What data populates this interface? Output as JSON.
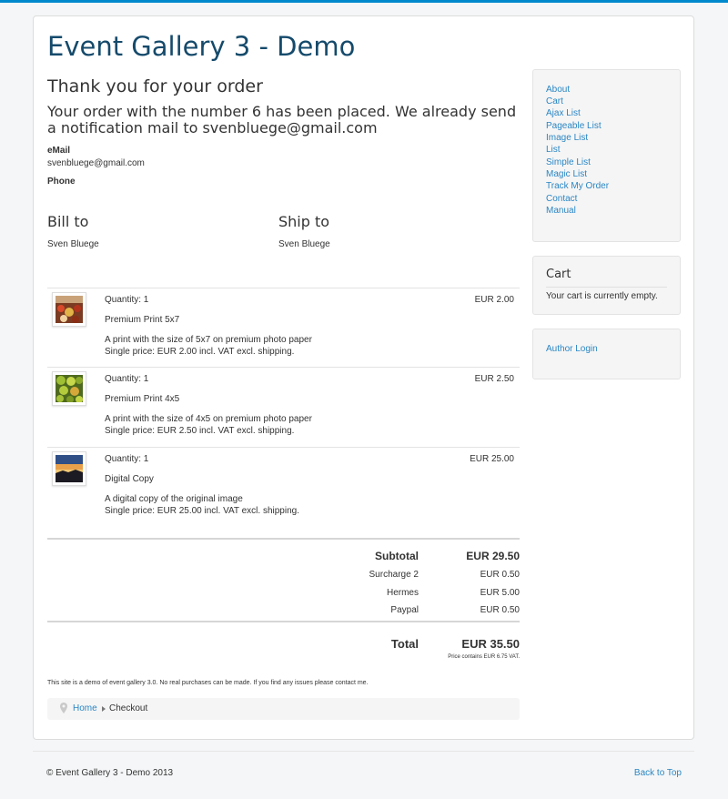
{
  "site": {
    "title": "Event Gallery 3 - Demo"
  },
  "confirmation": {
    "heading": "Thank you for your order",
    "message": "Your order with the number 6 has been placed. We already send a notification mail to svenbluege@gmail.com",
    "email_label": "eMail",
    "email_value": "svenbluege@gmail.com",
    "phone_label": "Phone"
  },
  "addresses": {
    "bill_to": {
      "title": "Bill to",
      "name": "Sven Bluege"
    },
    "ship_to": {
      "title": "Ship to",
      "name": "Sven Bluege"
    }
  },
  "items": [
    {
      "quantity": "Quantity: 1",
      "name": "Premium Print 5x7",
      "description": "A print with the size of 5x7 on premium photo paper",
      "single_price": "Single price: EUR 2.00 incl. VAT excl. shipping.",
      "price": "EUR 2.00",
      "thumb_icon": "market-photo-thumbnail"
    },
    {
      "quantity": "Quantity: 1",
      "name": "Premium Print 4x5",
      "description": "A print with the size of 4x5 on premium photo paper",
      "single_price": "Single price: EUR 2.50 incl. VAT excl. shipping.",
      "price": "EUR 2.50",
      "thumb_icon": "fruit-photo-thumbnail"
    },
    {
      "quantity": "Quantity: 1",
      "name": "Digital Copy",
      "description": "A digital copy of the original image",
      "single_price": "Single price: EUR 25.00 incl. VAT excl. shipping.",
      "price": "EUR 25.00",
      "thumb_icon": "sunset-photo-thumbnail"
    }
  ],
  "totals": {
    "subtotal_label": "Subtotal",
    "subtotal_value": "EUR 29.50",
    "surcharge_label": "Surcharge 2",
    "surcharge_value": "EUR 0.50",
    "shipping_label": "Hermes",
    "shipping_value": "EUR 5.00",
    "payment_label": "Paypal",
    "payment_value": "EUR 0.50",
    "total_label": "Total",
    "total_value": "EUR 35.50",
    "vat_note": "Price contains EUR 6.75 VAT."
  },
  "demo_note": "This site is a demo of event gallery 3.0. No real purchases can be made. If you find any issues please contact me.",
  "breadcrumb": {
    "home": "Home",
    "current": "Checkout",
    "icon": "map-pin-icon"
  },
  "sidebar": {
    "menu": [
      "About",
      "Cart",
      "Ajax List",
      "Pageable List",
      "Image List",
      "List",
      "Simple List",
      "Magic List",
      "Track My Order",
      "Contact",
      "Manual"
    ],
    "cart_title": "Cart",
    "cart_empty": "Your cart is currently empty.",
    "author_login": "Author Login"
  },
  "footer": {
    "copyright": "© Event Gallery 3 - Demo 2013",
    "back_to_top": "Back to Top"
  },
  "colors": {
    "accent": "#0088cc",
    "title": "#154a6b",
    "link": "#2a86c4"
  }
}
